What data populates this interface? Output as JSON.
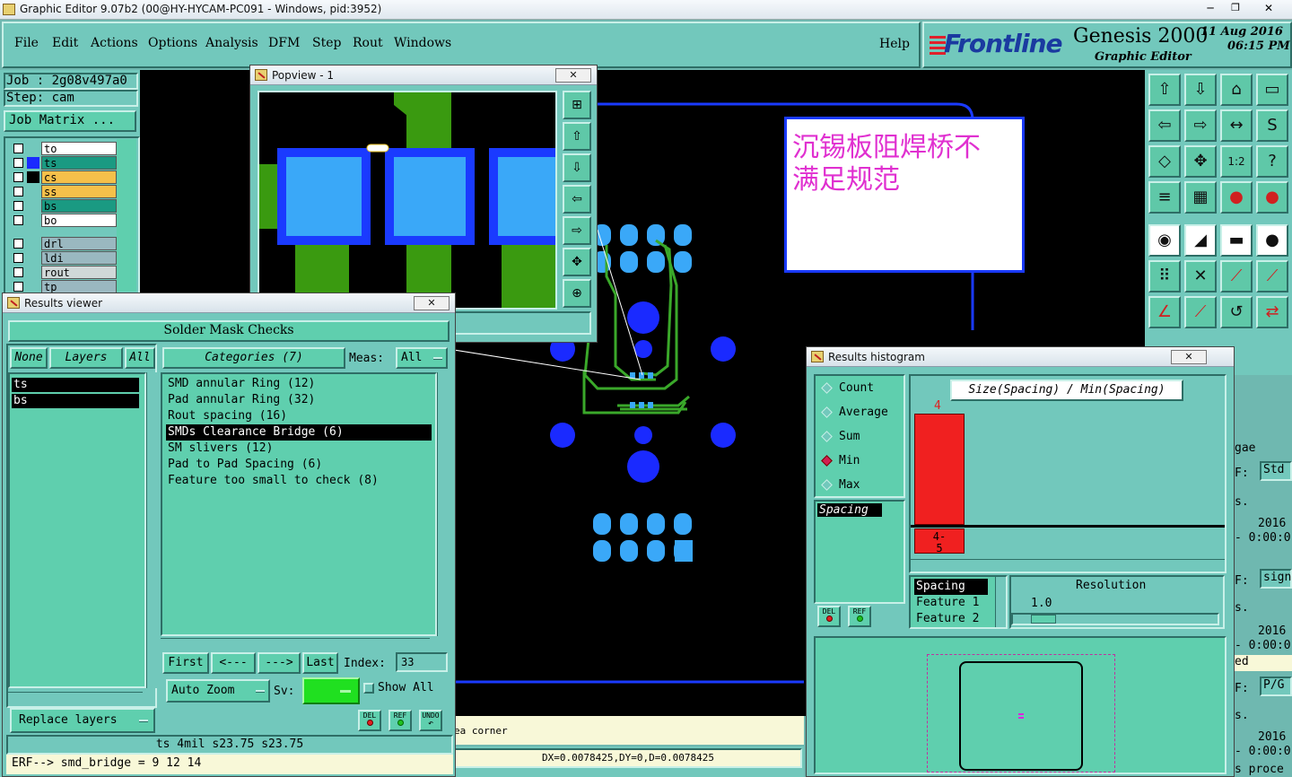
{
  "window": {
    "title": "Graphic Editor 9.07b2 (00@HY-HYCAM-PC091 - Windows, pid:3952)"
  },
  "menu": {
    "items": [
      "File",
      "Edit",
      "Actions",
      "Options",
      "Analysis",
      "DFM",
      "Step",
      "Rout",
      "Windows"
    ],
    "help": "Help"
  },
  "brand": {
    "logo": "Frontline",
    "product": "Genesis 2000",
    "subtitle": "Graphic Editor",
    "date": "11 Aug 2016",
    "time": "06:15 PM"
  },
  "job": {
    "job_label": "Job : 2g08v497a0",
    "step_label": "Step: cam",
    "matrix_button": "Job Matrix ..."
  },
  "layers": [
    {
      "name": "to",
      "color": "#ffffff"
    },
    {
      "name": "ts",
      "color": "#1a9a82"
    },
    {
      "name": "cs",
      "color": "#f5c04a"
    },
    {
      "name": "ss",
      "color": "#f5c04a"
    },
    {
      "name": "bs",
      "color": "#1a9a82"
    },
    {
      "name": "bo",
      "color": "#ffffff"
    },
    {
      "name": "drl",
      "color": "#9ab8c0"
    },
    {
      "name": "ldi",
      "color": "#9ab8c0"
    },
    {
      "name": "rout",
      "color": "#d0d8d8"
    },
    {
      "name": "tp",
      "color": "#9ab8c0"
    }
  ],
  "popview": {
    "title": "Popview - 1"
  },
  "annotation": {
    "text_line1": "沉锡板阻焊桥不",
    "text_line2": "满足规范"
  },
  "results_viewer": {
    "title": "Results viewer",
    "heading": "Solder Mask Checks",
    "none_label": "None",
    "layers_label": "Layers",
    "all_label": "All",
    "categories_label": "Categories (7)",
    "meas_label": "Meas:",
    "meas_value": "All",
    "layer_items": [
      "ts",
      "bs"
    ],
    "categories": [
      "SMD annular Ring (12)",
      "Pad annular Ring (32)",
      "Rout spacing (16)",
      "SMDs Clearance Bridge (6)",
      "SM slivers (12)",
      "Pad to Pad Spacing (6)",
      "Feature too small to check (8)"
    ],
    "selected_category": "SMDs Clearance Bridge (6)",
    "first": "First",
    "prev": "<---",
    "next": "--->",
    "last": "Last",
    "index_label": "Index:",
    "index_value": "33",
    "auto_zoom": "Auto Zoom",
    "sv_label": "Sv:",
    "show_all": "Show All",
    "replace_layers": "Replace layers",
    "del": "DEL",
    "ref": "REF",
    "undo": "UNDO",
    "status_line": "ts 4mil   s23.75   s23.75",
    "erf_line": "ERF--> smd_bridge = 9 12 14"
  },
  "histogram": {
    "title": "Results histogram",
    "modes": [
      "Count",
      "Average",
      "Sum",
      "Min",
      "Max"
    ],
    "selected_mode": "Min",
    "measure_item": "Spacing",
    "chart_title": "Size(Spacing) / Min(Spacing)",
    "bar_value": "4",
    "bar_label_top": "4-",
    "bar_label_bottom": "5",
    "fields": [
      "Spacing",
      "Feature 1",
      "Feature 2"
    ],
    "resolution_label": "Resolution",
    "resolution_value": "1.0",
    "del": "DEL",
    "ref": "REF"
  },
  "status": {
    "message": "ea corner",
    "coords": "DX=0.0078425,DY=0,D=0.0078425"
  },
  "right_partial": {
    "t1": "gae",
    "t2": "F:",
    "t3": "Std",
    "t4": "s.",
    "t5": "2016",
    "t6": "- 0:00:0",
    "t7": "F:",
    "t8": "sign",
    "t9": "s.",
    "t10": "2016",
    "t11": "- 0:00:0",
    "t12": "ed",
    "t13": "F:",
    "t14": "P/G",
    "t15": "s.",
    "t16": "2016",
    "t17": "- 0:00:0",
    "t18": "s proce"
  }
}
